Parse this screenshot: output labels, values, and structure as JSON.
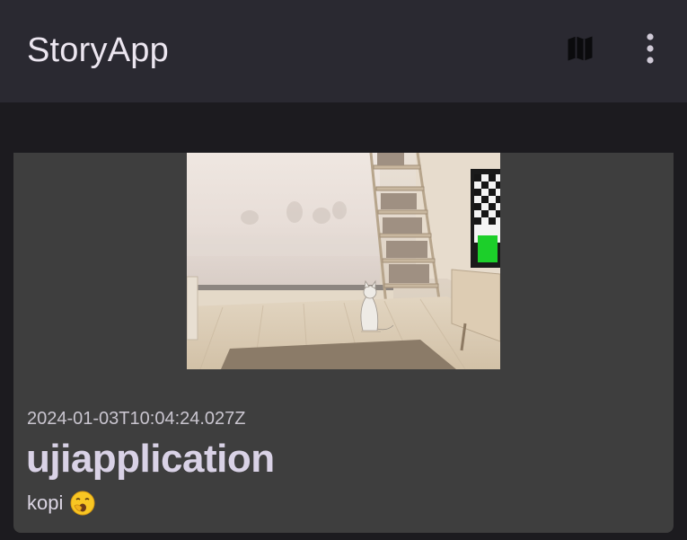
{
  "app_bar": {
    "title": "StoryApp",
    "actions": [
      {
        "icon": "map-icon"
      },
      {
        "icon": "more-vertical-icon"
      }
    ]
  },
  "stories": [
    {
      "created_at": "2024-01-03T10:04:24.027Z",
      "name": "ujiapplication",
      "description": "kopi",
      "description_emoji": "yawning-face-icon",
      "photo": "living-room-with-cat"
    }
  ]
}
